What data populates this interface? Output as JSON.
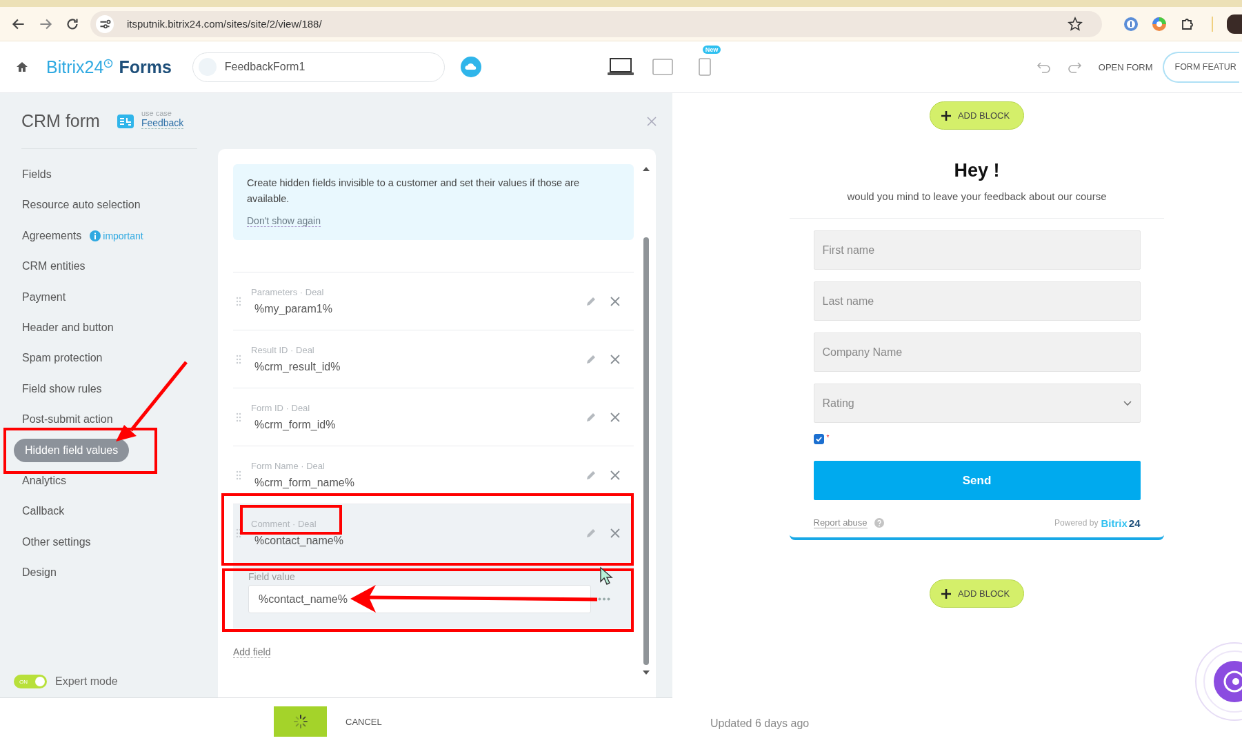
{
  "browser": {
    "url": "itsputnik.bitrix24.com/sites/site/2/view/188/"
  },
  "header": {
    "logo_brand": "Bitrix24",
    "logo_product": "Forms",
    "form_name": "FeedbackForm1",
    "new_badge": "New",
    "open_form": "OPEN FORM",
    "features": "FORM FEATUR"
  },
  "panel": {
    "title": "CRM form",
    "use_case_label": "use case",
    "use_case": "Feedback"
  },
  "sidebar": {
    "items": [
      {
        "label": "Fields",
        "selected": false
      },
      {
        "label": "Resource auto selection",
        "selected": false
      },
      {
        "label": "Agreements",
        "selected": false,
        "badge": "important"
      },
      {
        "label": "CRM entities",
        "selected": false
      },
      {
        "label": "Payment",
        "selected": false
      },
      {
        "label": "Header and button",
        "selected": false
      },
      {
        "label": "Spam protection",
        "selected": false
      },
      {
        "label": "Field show rules",
        "selected": false
      },
      {
        "label": "Post-submit action",
        "selected": false
      },
      {
        "label": "Hidden field values",
        "selected": true
      },
      {
        "label": "Analytics",
        "selected": false
      },
      {
        "label": "Callback",
        "selected": false
      },
      {
        "label": "Other settings",
        "selected": false
      },
      {
        "label": "Design",
        "selected": false
      }
    ],
    "expert_mode": {
      "label": "Expert mode",
      "switch_text": "ON",
      "on": true
    }
  },
  "hint": {
    "text": "Create hidden fields invisible to a customer and set their values if those are available.",
    "dismiss": "Don't show again"
  },
  "fields": [
    {
      "label": "Parameters · Deal",
      "value": "%my_param1%",
      "expanded": false
    },
    {
      "label": "Result ID · Deal",
      "value": "%crm_result_id%",
      "expanded": false
    },
    {
      "label": "Form ID · Deal",
      "value": "%crm_form_id%",
      "expanded": false
    },
    {
      "label": "Form Name · Deal",
      "value": "%crm_form_name%",
      "expanded": false
    },
    {
      "label": "Comment · Deal",
      "value": "%contact_name%",
      "expanded": true,
      "editor": {
        "label": "Field value",
        "value": "%contact_name%"
      }
    }
  ],
  "add_field": "Add field",
  "footer": {
    "save_loading": true,
    "cancel": "CANCEL"
  },
  "preview": {
    "add_block_top": "ADD BLOCK",
    "title": "Hey !",
    "subtitle": "would you mind to leave your feedback about our course",
    "inputs": [
      {
        "kind": "text",
        "placeholder": "First name"
      },
      {
        "kind": "text",
        "placeholder": "Last name"
      },
      {
        "kind": "text",
        "placeholder": "Company Name"
      },
      {
        "kind": "select",
        "placeholder": "Rating"
      }
    ],
    "consent": {
      "checked": true,
      "required_mark": "*"
    },
    "submit": "Send",
    "report": "Report abuse",
    "powered_by": "Powered by",
    "brand_a": "Bitrix",
    "brand_b": "24",
    "add_block_bottom": "ADD BLOCK",
    "updated": "Updated 6 days ago"
  }
}
